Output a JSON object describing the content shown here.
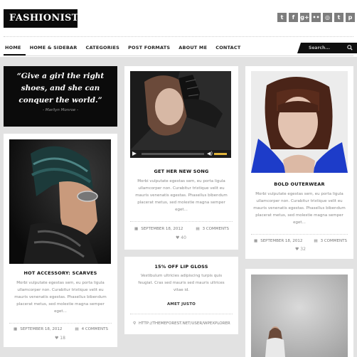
{
  "site": {
    "logo": "FASHIONISTA"
  },
  "social_icons": [
    {
      "name": "twitter-icon",
      "glyph": "t"
    },
    {
      "name": "facebook-icon",
      "glyph": "f"
    },
    {
      "name": "googleplus-icon",
      "glyph": "g+"
    },
    {
      "name": "flickr-icon",
      "glyph": "••"
    },
    {
      "name": "dribbble-icon",
      "glyph": "◎"
    },
    {
      "name": "tumblr-icon",
      "glyph": "t"
    },
    {
      "name": "pinterest-icon",
      "glyph": "p"
    }
  ],
  "nav": {
    "items": [
      "HOME",
      "HOME & SIDEBAR",
      "CATEGORIES",
      "POST FORMATS",
      "ABOUT ME",
      "CONTACT"
    ],
    "search_placeholder": "Search..."
  },
  "quote": {
    "text": "“Give a girl the right shoes, and she can conquer the world.”",
    "author": "- Marilyn Monroe -"
  },
  "posts": {
    "scarves": {
      "title": "HOT ACCESSORY: SCARVES",
      "excerpt": "Morbi vulputate egestas sem, eu porta ligula ullamcorper non. Curabitur tristique velit eu mauris venenatis egestas. Phasellus bibendum placerat metus, sed molestie magna semper eget...",
      "date": "SEPTEMBER 18, 2012",
      "comments": "4 COMMENTS",
      "likes": "18"
    },
    "song": {
      "title": "GET HER NEW SONG",
      "excerpt": "Morbi vulputate egestas sem, eu porta ligula ullamcorper non. Curabitur tristique velit eu mauris venenatis egestas. Phasellus bibendum placerat metus, sed molestie magna semper eget...",
      "date": "SEPTEMBER 18, 2012",
      "comments": "3 COMMENTS",
      "likes": "40"
    },
    "lipgloss": {
      "title": "15% OFF LIP GLOSS",
      "excerpt": "Vestibulum ultricies adipiscing turpis quis feugiat. Cras sed mauris sed mauris ultrices vitae id.",
      "author": "AMET JUSTO",
      "link": "HTTP://THEMEFOREST.NET/USER/WPEXPLORER"
    },
    "outerwear": {
      "title": "BOLD OUTERWEAR",
      "excerpt": "Morbi vulputate egestas sem, eu porta ligula ullamcorper non. Curabitur tristique velit eu mauris venenatis egestas. Phasellus bibendum placerat metus, sed molestie magna semper eget...",
      "date": "SEPTEMBER 18, 2012",
      "comments": "3 COMMENTS",
      "likes": "32"
    }
  },
  "colors": {
    "accent": "#0b0b0b",
    "player_volume": "#e0b33b",
    "background": "#e2e2e2"
  }
}
